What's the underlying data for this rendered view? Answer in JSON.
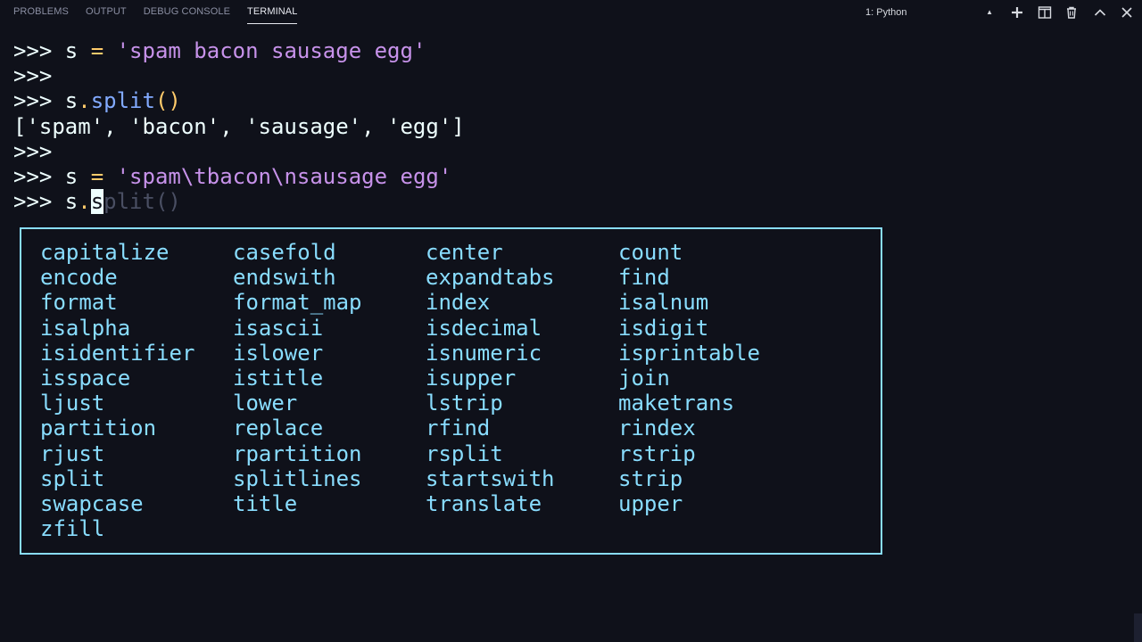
{
  "panel": {
    "tabs": [
      {
        "label": "PROBLEMS",
        "active": false
      },
      {
        "label": "OUTPUT",
        "active": false
      },
      {
        "label": "DEBUG CONSOLE",
        "active": false
      },
      {
        "label": "TERMINAL",
        "active": true
      }
    ],
    "terminal_select": {
      "selected": "1: Python"
    },
    "icons": [
      "plus-icon",
      "split-icon",
      "trash-icon",
      "chevron-up-icon",
      "close-icon"
    ]
  },
  "colors": {
    "background": "#0f111a",
    "prompt": "#eeffff",
    "operator": "#ffcb6b",
    "string": "#c792ea",
    "function": "#82aaff",
    "completion": "#89ddff",
    "ghost": "#4a4f63"
  },
  "terminal": {
    "lines": [
      {
        "prompt": ">>> ",
        "var": "s ",
        "op": "=",
        "str": " 'spam bacon sausage egg'"
      },
      {
        "prompt": ">>>"
      },
      {
        "prompt": ">>> ",
        "obj": "s",
        "dot": ".",
        "fn": "split",
        "paren": "()"
      },
      {
        "output": "['spam', 'bacon', 'sausage', 'egg']"
      },
      {
        "prompt": ">>>"
      },
      {
        "prompt": ">>> ",
        "var": "s ",
        "op": "=",
        "str": " 'spam\\tbacon\\nsausage egg'"
      },
      {
        "prompt": ">>> ",
        "obj": "s",
        "dot": ".",
        "typed": "s",
        "ghost": "plit()"
      }
    ]
  },
  "completions": [
    "capitalize",
    "casefold",
    "center",
    "count",
    "encode",
    "endswith",
    "expandtabs",
    "find",
    "format",
    "format_map",
    "index",
    "isalnum",
    "isalpha",
    "isascii",
    "isdecimal",
    "isdigit",
    "isidentifier",
    "islower",
    "isnumeric",
    "isprintable",
    "isspace",
    "istitle",
    "isupper",
    "join",
    "ljust",
    "lower",
    "lstrip",
    "maketrans",
    "partition",
    "replace",
    "rfind",
    "rindex",
    "rjust",
    "rpartition",
    "rsplit",
    "rstrip",
    "split",
    "splitlines",
    "startswith",
    "strip",
    "swapcase",
    "title",
    "translate",
    "upper",
    "zfill"
  ]
}
